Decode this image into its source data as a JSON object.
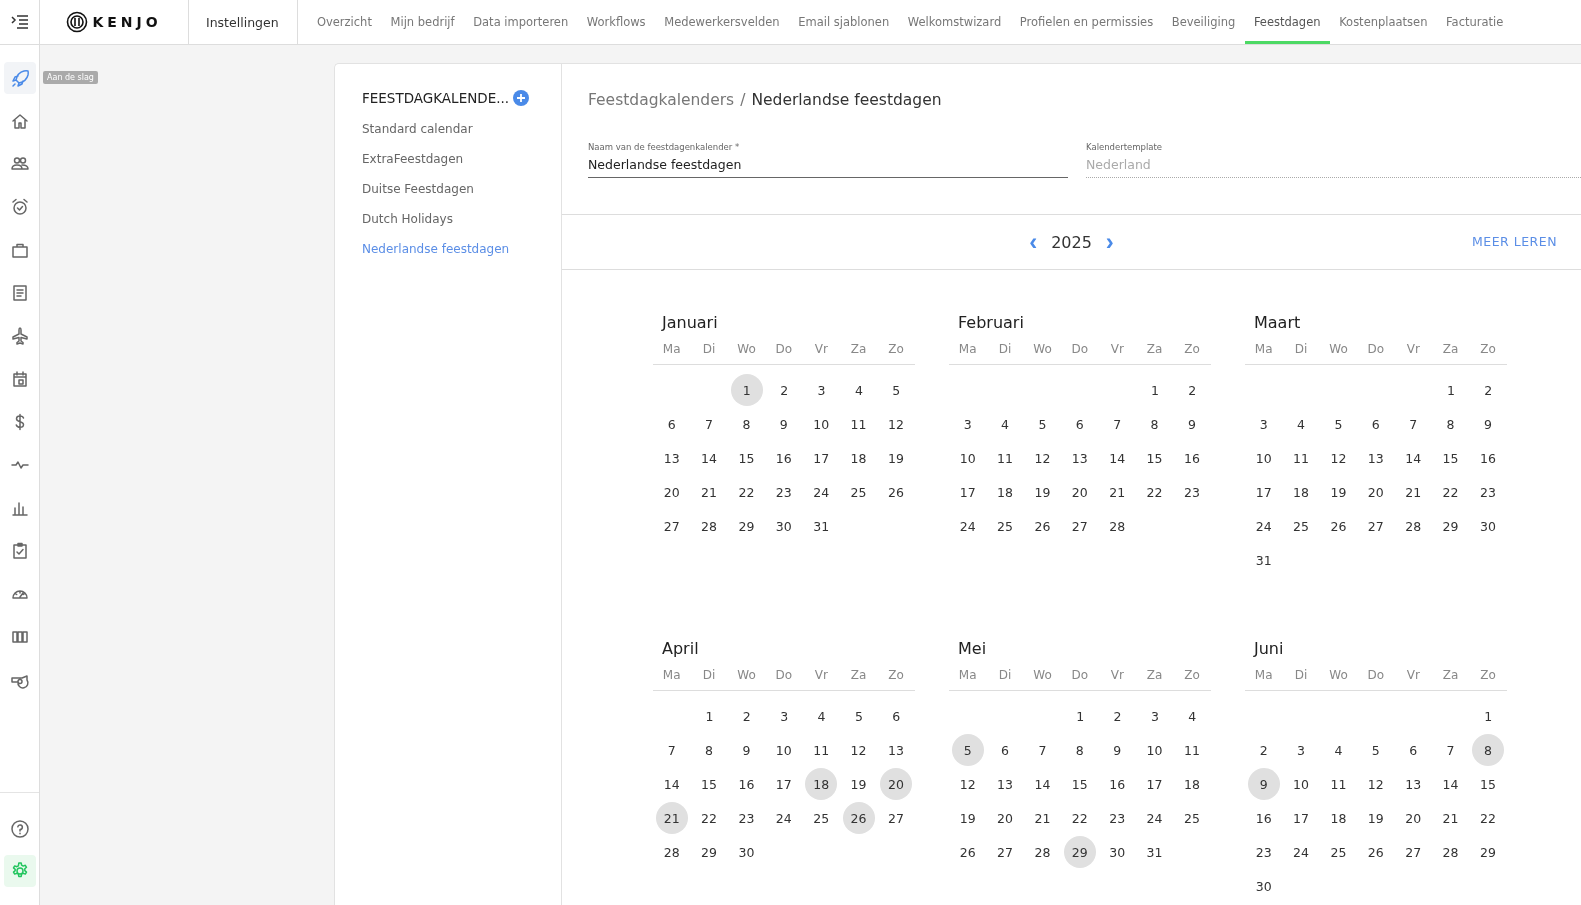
{
  "top_bar": {
    "section": "Instellingen",
    "tabs": [
      {
        "label": "Overzicht",
        "selected": false
      },
      {
        "label": "Mijn bedrijf",
        "selected": false
      },
      {
        "label": "Data importeren",
        "selected": false
      },
      {
        "label": "Workflows",
        "selected": false
      },
      {
        "label": "Medewerkersvelden",
        "selected": false
      },
      {
        "label": "Email sjablonen",
        "selected": false
      },
      {
        "label": "Welkomstwizard",
        "selected": false
      },
      {
        "label": "Profielen en permissies",
        "selected": false
      },
      {
        "label": "Beveiliging",
        "selected": false
      },
      {
        "label": "Feestdagen",
        "selected": true
      },
      {
        "label": "Kostenplaatsen",
        "selected": false
      },
      {
        "label": "Facturatie",
        "selected": false
      }
    ]
  },
  "logo": "KENJO",
  "sidebar": {
    "tooltip": "Aan de slag",
    "items": [
      {
        "kind": "rocket",
        "selected": true
      },
      {
        "kind": "home",
        "selected": false
      },
      {
        "kind": "people",
        "selected": false
      },
      {
        "kind": "alarm",
        "selected": false
      },
      {
        "kind": "briefcase",
        "selected": false
      },
      {
        "kind": "document",
        "selected": false
      },
      {
        "kind": "plane",
        "selected": false
      },
      {
        "kind": "calendar",
        "selected": false
      },
      {
        "kind": "dollar",
        "selected": false
      },
      {
        "kind": "pulse",
        "selected": false
      },
      {
        "kind": "chart",
        "selected": false
      },
      {
        "kind": "checklist",
        "selected": false
      },
      {
        "kind": "gauge",
        "selected": false
      },
      {
        "kind": "columns",
        "selected": false
      },
      {
        "kind": "whistle",
        "selected": false
      }
    ],
    "bottom_items": [
      {
        "kind": "help",
        "selected": false
      },
      {
        "kind": "settings",
        "selected": true
      }
    ]
  },
  "calendar_list": {
    "title": "FEESTDAGKALENDE...",
    "items": [
      {
        "label": "Standard calendar",
        "selected": false
      },
      {
        "label": "ExtraFeestdagen",
        "selected": false
      },
      {
        "label": "Duitse Feestdagen",
        "selected": false
      },
      {
        "label": "Dutch Holidays",
        "selected": false
      },
      {
        "label": "Nederlandse feestdagen",
        "selected": true
      }
    ]
  },
  "breadcrumb": {
    "parent": "Feestdagkalenders",
    "separator": "/",
    "current": "Nederlandse feestdagen"
  },
  "fields": [
    {
      "label": "Naam van de feestdagenkalender *",
      "value": "Nederlandse feestdagen",
      "disabled": false
    },
    {
      "label": "Kalendertemplate",
      "value": "Nederland",
      "disabled": true
    }
  ],
  "year_nav": {
    "prev": "‹",
    "year": "2025",
    "next": "›",
    "link": "MEER LEREN"
  },
  "months": [
    {
      "name": "Januari",
      "weekdays": [
        "Ma",
        "Di",
        "Wo",
        "Do",
        "Vr",
        "Za",
        "Zo"
      ],
      "weeks": [
        {
          "right_aligned": true,
          "days": [
            {
              "label": "1",
              "holiday": true
            },
            {
              "label": "2",
              "holiday": false
            },
            {
              "label": "3",
              "holiday": false
            },
            {
              "label": "4",
              "holiday": false
            },
            {
              "label": "5",
              "holiday": false
            }
          ]
        },
        {
          "right_aligned": false,
          "days": [
            {
              "label": "6",
              "holiday": false
            },
            {
              "label": "7",
              "holiday": false
            },
            {
              "label": "8",
              "holiday": false
            },
            {
              "label": "9",
              "holiday": false
            },
            {
              "label": "10",
              "holiday": false
            },
            {
              "label": "11",
              "holiday": false
            },
            {
              "label": "12",
              "holiday": false
            }
          ]
        },
        {
          "right_aligned": false,
          "days": [
            {
              "label": "13",
              "holiday": false
            },
            {
              "label": "14",
              "holiday": false
            },
            {
              "label": "15",
              "holiday": false
            },
            {
              "label": "16",
              "holiday": false
            },
            {
              "label": "17",
              "holiday": false
            },
            {
              "label": "18",
              "holiday": false
            },
            {
              "label": "19",
              "holiday": false
            }
          ]
        },
        {
          "right_aligned": false,
          "days": [
            {
              "label": "20",
              "holiday": false
            },
            {
              "label": "21",
              "holiday": false
            },
            {
              "label": "22",
              "holiday": false
            },
            {
              "label": "23",
              "holiday": false
            },
            {
              "label": "24",
              "holiday": false
            },
            {
              "label": "25",
              "holiday": false
            },
            {
              "label": "26",
              "holiday": false
            }
          ]
        },
        {
          "right_aligned": false,
          "days": [
            {
              "label": "27",
              "holiday": false
            },
            {
              "label": "28",
              "holiday": false
            },
            {
              "label": "29",
              "holiday": false
            },
            {
              "label": "30",
              "holiday": false
            },
            {
              "label": "31",
              "holiday": false
            }
          ]
        }
      ]
    },
    {
      "name": "Februari",
      "weekdays": [
        "Ma",
        "Di",
        "Wo",
        "Do",
        "Vr",
        "Za",
        "Zo"
      ],
      "weeks": [
        {
          "right_aligned": true,
          "days": [
            {
              "label": "1",
              "holiday": false
            },
            {
              "label": "2",
              "holiday": false
            }
          ]
        },
        {
          "right_aligned": false,
          "days": [
            {
              "label": "3",
              "holiday": false
            },
            {
              "label": "4",
              "holiday": false
            },
            {
              "label": "5",
              "holiday": false
            },
            {
              "label": "6",
              "holiday": false
            },
            {
              "label": "7",
              "holiday": false
            },
            {
              "label": "8",
              "holiday": false
            },
            {
              "label": "9",
              "holiday": false
            }
          ]
        },
        {
          "right_aligned": false,
          "days": [
            {
              "label": "10",
              "holiday": false
            },
            {
              "label": "11",
              "holiday": false
            },
            {
              "label": "12",
              "holiday": false
            },
            {
              "label": "13",
              "holiday": false
            },
            {
              "label": "14",
              "holiday": false
            },
            {
              "label": "15",
              "holiday": false
            },
            {
              "label": "16",
              "holiday": false
            }
          ]
        },
        {
          "right_aligned": false,
          "days": [
            {
              "label": "17",
              "holiday": false
            },
            {
              "label": "18",
              "holiday": false
            },
            {
              "label": "19",
              "holiday": false
            },
            {
              "label": "20",
              "holiday": false
            },
            {
              "label": "21",
              "holiday": false
            },
            {
              "label": "22",
              "holiday": false
            },
            {
              "label": "23",
              "holiday": false
            }
          ]
        },
        {
          "right_aligned": false,
          "days": [
            {
              "label": "24",
              "holiday": false
            },
            {
              "label": "25",
              "holiday": false
            },
            {
              "label": "26",
              "holiday": false
            },
            {
              "label": "27",
              "holiday": false
            },
            {
              "label": "28",
              "holiday": false
            }
          ]
        }
      ]
    },
    {
      "name": "Maart",
      "weekdays": [
        "Ma",
        "Di",
        "Wo",
        "Do",
        "Vr",
        "Za",
        "Zo"
      ],
      "weeks": [
        {
          "right_aligned": true,
          "days": [
            {
              "label": "1",
              "holiday": false
            },
            {
              "label": "2",
              "holiday": false
            }
          ]
        },
        {
          "right_aligned": false,
          "days": [
            {
              "label": "3",
              "holiday": false
            },
            {
              "label": "4",
              "holiday": false
            },
            {
              "label": "5",
              "holiday": false
            },
            {
              "label": "6",
              "holiday": false
            },
            {
              "label": "7",
              "holiday": false
            },
            {
              "label": "8",
              "holiday": false
            },
            {
              "label": "9",
              "holiday": false
            }
          ]
        },
        {
          "right_aligned": false,
          "days": [
            {
              "label": "10",
              "holiday": false
            },
            {
              "label": "11",
              "holiday": false
            },
            {
              "label": "12",
              "holiday": false
            },
            {
              "label": "13",
              "holiday": false
            },
            {
              "label": "14",
              "holiday": false
            },
            {
              "label": "15",
              "holiday": false
            },
            {
              "label": "16",
              "holiday": false
            }
          ]
        },
        {
          "right_aligned": false,
          "days": [
            {
              "label": "17",
              "holiday": false
            },
            {
              "label": "18",
              "holiday": false
            },
            {
              "label": "19",
              "holiday": false
            },
            {
              "label": "20",
              "holiday": false
            },
            {
              "label": "21",
              "holiday": false
            },
            {
              "label": "22",
              "holiday": false
            },
            {
              "label": "23",
              "holiday": false
            }
          ]
        },
        {
          "right_aligned": false,
          "days": [
            {
              "label": "24",
              "holiday": false
            },
            {
              "label": "25",
              "holiday": false
            },
            {
              "label": "26",
              "holiday": false
            },
            {
              "label": "27",
              "holiday": false
            },
            {
              "label": "28",
              "holiday": false
            },
            {
              "label": "29",
              "holiday": false
            },
            {
              "label": "30",
              "holiday": false
            }
          ]
        },
        {
          "right_aligned": false,
          "days": [
            {
              "label": "31",
              "holiday": false
            }
          ]
        }
      ]
    },
    {
      "name": "April",
      "weekdays": [
        "Ma",
        "Di",
        "Wo",
        "Do",
        "Vr",
        "Za",
        "Zo"
      ],
      "weeks": [
        {
          "right_aligned": true,
          "days": [
            {
              "label": "1",
              "holiday": false
            },
            {
              "label": "2",
              "holiday": false
            },
            {
              "label": "3",
              "holiday": false
            },
            {
              "label": "4",
              "holiday": false
            },
            {
              "label": "5",
              "holiday": false
            },
            {
              "label": "6",
              "holiday": false
            }
          ]
        },
        {
          "right_aligned": false,
          "days": [
            {
              "label": "7",
              "holiday": false
            },
            {
              "label": "8",
              "holiday": false
            },
            {
              "label": "9",
              "holiday": false
            },
            {
              "label": "10",
              "holiday": false
            },
            {
              "label": "11",
              "holiday": false
            },
            {
              "label": "12",
              "holiday": false
            },
            {
              "label": "13",
              "holiday": false
            }
          ]
        },
        {
          "right_aligned": false,
          "days": [
            {
              "label": "14",
              "holiday": false
            },
            {
              "label": "15",
              "holiday": false
            },
            {
              "label": "16",
              "holiday": false
            },
            {
              "label": "17",
              "holiday": false
            },
            {
              "label": "18",
              "holiday": true
            },
            {
              "label": "19",
              "holiday": false
            },
            {
              "label": "20",
              "holiday": true
            }
          ]
        },
        {
          "right_aligned": false,
          "days": [
            {
              "label": "21",
              "holiday": true
            },
            {
              "label": "22",
              "holiday": false
            },
            {
              "label": "23",
              "holiday": false
            },
            {
              "label": "24",
              "holiday": false
            },
            {
              "label": "25",
              "holiday": false
            },
            {
              "label": "26",
              "holiday": true
            },
            {
              "label": "27",
              "holiday": false
            }
          ]
        },
        {
          "right_aligned": false,
          "days": [
            {
              "label": "28",
              "holiday": false
            },
            {
              "label": "29",
              "holiday": false
            },
            {
              "label": "30",
              "holiday": false
            }
          ]
        }
      ]
    },
    {
      "name": "Mei",
      "weekdays": [
        "Ma",
        "Di",
        "Wo",
        "Do",
        "Vr",
        "Za",
        "Zo"
      ],
      "weeks": [
        {
          "right_aligned": true,
          "days": [
            {
              "label": "1",
              "holiday": false
            },
            {
              "label": "2",
              "holiday": false
            },
            {
              "label": "3",
              "holiday": false
            },
            {
              "label": "4",
              "holiday": false
            }
          ]
        },
        {
          "right_aligned": false,
          "days": [
            {
              "label": "5",
              "holiday": true
            },
            {
              "label": "6",
              "holiday": false
            },
            {
              "label": "7",
              "holiday": false
            },
            {
              "label": "8",
              "holiday": false
            },
            {
              "label": "9",
              "holiday": false
            },
            {
              "label": "10",
              "holiday": false
            },
            {
              "label": "11",
              "holiday": false
            }
          ]
        },
        {
          "right_aligned": false,
          "days": [
            {
              "label": "12",
              "holiday": false
            },
            {
              "label": "13",
              "holiday": false
            },
            {
              "label": "14",
              "holiday": false
            },
            {
              "label": "15",
              "holiday": false
            },
            {
              "label": "16",
              "holiday": false
            },
            {
              "label": "17",
              "holiday": false
            },
            {
              "label": "18",
              "holiday": false
            }
          ]
        },
        {
          "right_aligned": false,
          "days": [
            {
              "label": "19",
              "holiday": false
            },
            {
              "label": "20",
              "holiday": false
            },
            {
              "label": "21",
              "holiday": false
            },
            {
              "label": "22",
              "holiday": false
            },
            {
              "label": "23",
              "holiday": false
            },
            {
              "label": "24",
              "holiday": false
            },
            {
              "label": "25",
              "holiday": false
            }
          ]
        },
        {
          "right_aligned": false,
          "days": [
            {
              "label": "26",
              "holiday": false
            },
            {
              "label": "27",
              "holiday": false
            },
            {
              "label": "28",
              "holiday": false
            },
            {
              "label": "29",
              "holiday": true
            },
            {
              "label": "30",
              "holiday": false
            },
            {
              "label": "31",
              "holiday": false
            }
          ]
        }
      ]
    },
    {
      "name": "Juni",
      "weekdays": [
        "Ma",
        "Di",
        "Wo",
        "Do",
        "Vr",
        "Za",
        "Zo"
      ],
      "weeks": [
        {
          "right_aligned": true,
          "days": [
            {
              "label": "1",
              "holiday": false
            }
          ]
        },
        {
          "right_aligned": false,
          "days": [
            {
              "label": "2",
              "holiday": false
            },
            {
              "label": "3",
              "holiday": false
            },
            {
              "label": "4",
              "holiday": false
            },
            {
              "label": "5",
              "holiday": false
            },
            {
              "label": "6",
              "holiday": false
            },
            {
              "label": "7",
              "holiday": false
            },
            {
              "label": "8",
              "holiday": true
            }
          ]
        },
        {
          "right_aligned": false,
          "days": [
            {
              "label": "9",
              "holiday": true
            },
            {
              "label": "10",
              "holiday": false
            },
            {
              "label": "11",
              "holiday": false
            },
            {
              "label": "12",
              "holiday": false
            },
            {
              "label": "13",
              "holiday": false
            },
            {
              "label": "14",
              "holiday": false
            },
            {
              "label": "15",
              "holiday": false
            }
          ]
        },
        {
          "right_aligned": false,
          "days": [
            {
              "label": "16",
              "holiday": false
            },
            {
              "label": "17",
              "holiday": false
            },
            {
              "label": "18",
              "holiday": false
            },
            {
              "label": "19",
              "holiday": false
            },
            {
              "label": "20",
              "holiday": false
            },
            {
              "label": "21",
              "holiday": false
            },
            {
              "label": "22",
              "holiday": false
            }
          ]
        },
        {
          "right_aligned": false,
          "days": [
            {
              "label": "23",
              "holiday": false
            },
            {
              "label": "24",
              "holiday": false
            },
            {
              "label": "25",
              "holiday": false
            },
            {
              "label": "26",
              "holiday": false
            },
            {
              "label": "27",
              "holiday": false
            },
            {
              "label": "28",
              "holiday": false
            },
            {
              "label": "29",
              "holiday": false
            }
          ]
        },
        {
          "right_aligned": false,
          "days": [
            {
              "label": "30",
              "holiday": false
            }
          ]
        }
      ]
    }
  ]
}
